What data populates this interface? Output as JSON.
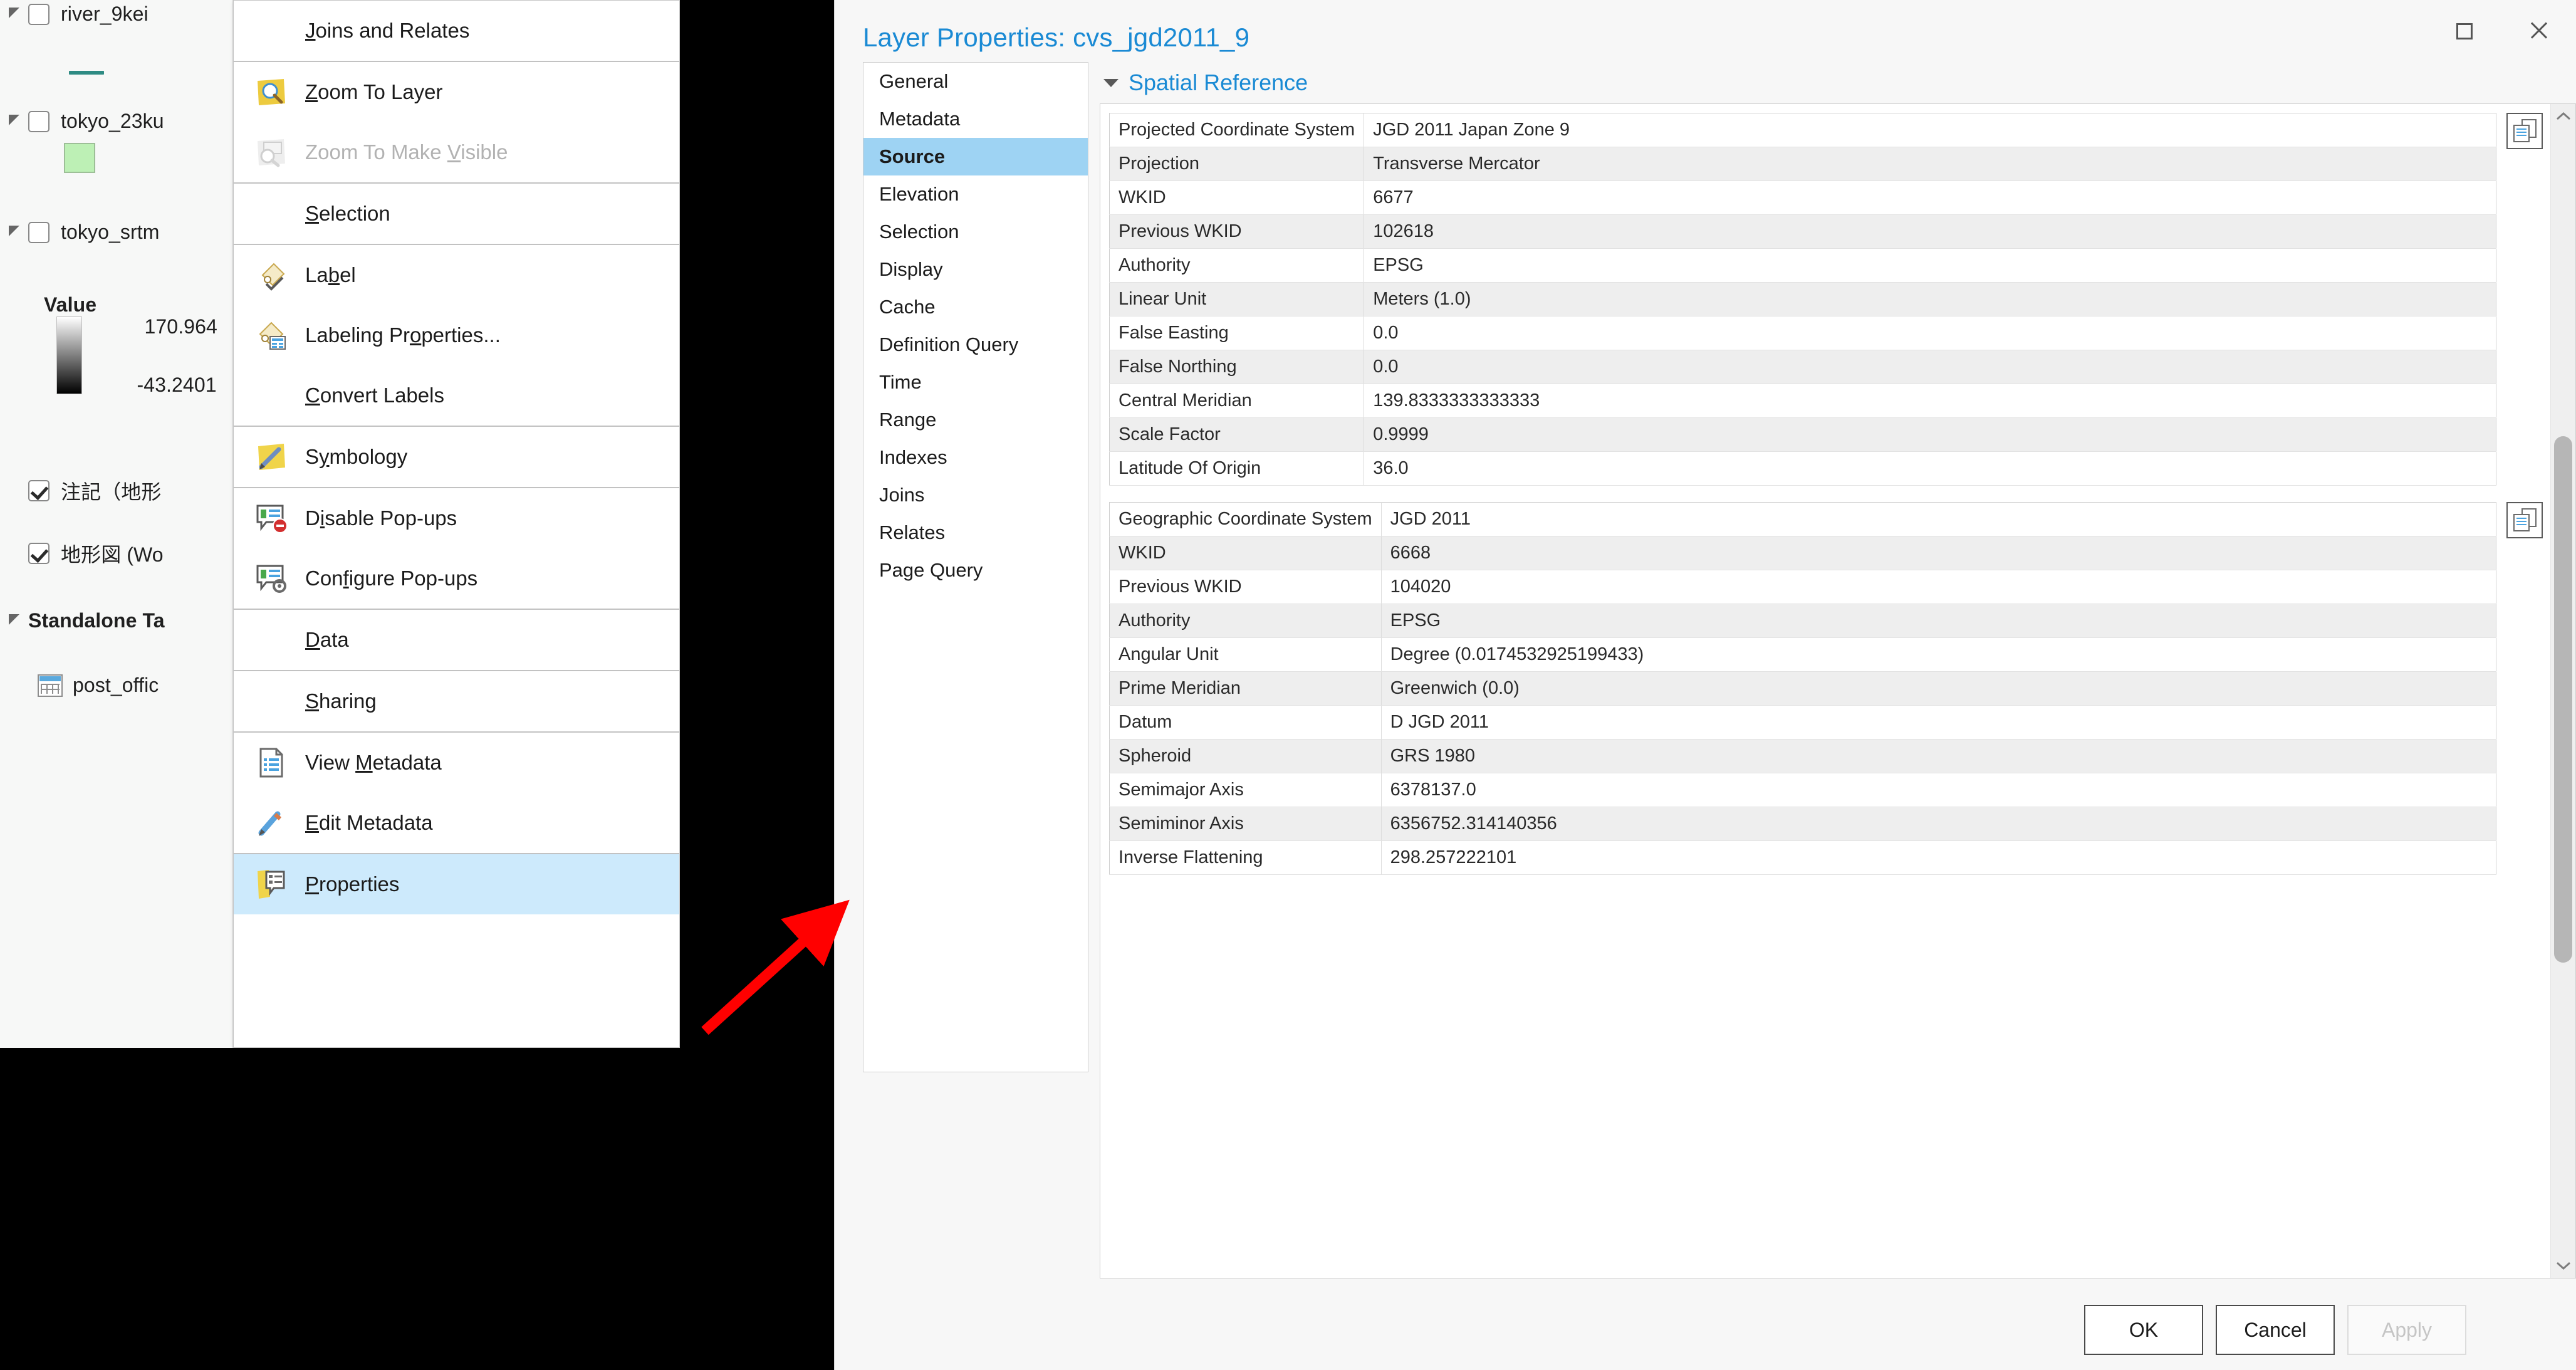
{
  "toc": {
    "items": [
      {
        "type": "layer",
        "label": "river_9kei",
        "checked": false,
        "expanded": true,
        "symbol": "line"
      },
      {
        "type": "layer",
        "label": "tokyo_23ku",
        "checked": false,
        "expanded": true,
        "symbol": "polygon"
      },
      {
        "type": "layer",
        "label": "tokyo_srtm",
        "checked": false,
        "expanded": true,
        "symbol": "ramp"
      },
      {
        "type": "legend-heading",
        "label": "Value"
      },
      {
        "type": "ramp-max",
        "label": "170.964"
      },
      {
        "type": "ramp-min",
        "label": "-43.2401"
      },
      {
        "type": "layer",
        "label": "注記（地形",
        "checked": true,
        "expanded": false
      },
      {
        "type": "layer",
        "label": "地形図 (Wo",
        "checked": true,
        "expanded": false
      },
      {
        "type": "group",
        "label": "Standalone Ta",
        "expanded": true
      },
      {
        "type": "table",
        "label": "post_offic"
      }
    ]
  },
  "context_menu": {
    "items": [
      {
        "label": "Joins and Relates",
        "accel": "J",
        "icon": "none",
        "disabled": false,
        "selected": false,
        "separator_after": true
      },
      {
        "label": "Zoom To Layer",
        "accel": "Z",
        "icon": "zoom-to-layer-icon",
        "disabled": false,
        "selected": false
      },
      {
        "label": "Zoom To Make Visible",
        "accel": "V",
        "icon": "zoom-to-make-visible-icon",
        "disabled": true,
        "selected": false,
        "separator_after": true
      },
      {
        "label": "Selection",
        "accel": "S",
        "icon": "none",
        "disabled": false,
        "selected": false,
        "separator_after": true
      },
      {
        "label": "Label",
        "accel": "b",
        "icon": "label-icon",
        "disabled": false,
        "selected": false
      },
      {
        "label": "Labeling Properties...",
        "accel": "o",
        "icon": "labeling-properties-icon",
        "disabled": false,
        "selected": false
      },
      {
        "label": "Convert Labels",
        "accel": "C",
        "icon": "none",
        "disabled": false,
        "selected": false,
        "separator_after": true
      },
      {
        "label": "Symbology",
        "accel": "y",
        "icon": "symbology-icon",
        "disabled": false,
        "selected": false,
        "separator_after": true
      },
      {
        "label": "Disable Pop-ups",
        "accel": "i",
        "icon": "disable-popups-icon",
        "disabled": false,
        "selected": false
      },
      {
        "label": "Configure Pop-ups",
        "accel": "f",
        "icon": "configure-popups-icon",
        "disabled": false,
        "selected": false,
        "separator_after": true
      },
      {
        "label": "Data",
        "accel": "D",
        "icon": "none",
        "disabled": false,
        "selected": false,
        "separator_after": true
      },
      {
        "label": "Sharing",
        "accel": "S",
        "icon": "none",
        "disabled": false,
        "selected": false,
        "separator_after": true
      },
      {
        "label": "View Metadata",
        "accel": "M",
        "icon": "view-metadata-icon",
        "disabled": false,
        "selected": false
      },
      {
        "label": "Edit Metadata",
        "accel": "E",
        "icon": "edit-metadata-icon",
        "disabled": false,
        "selected": false,
        "separator_after": true
      },
      {
        "label": "Properties",
        "accel": "P",
        "icon": "properties-icon",
        "disabled": false,
        "selected": true
      }
    ]
  },
  "dialog": {
    "title": "Layer Properties: cvs_jgd2011_9",
    "titlebar": {
      "maximize": "maximize-icon",
      "close": "close-icon"
    },
    "tabs": [
      {
        "label": "General",
        "active": false
      },
      {
        "label": "Metadata",
        "active": false
      },
      {
        "label": "Source",
        "active": true
      },
      {
        "label": "Elevation",
        "active": false
      },
      {
        "label": "Selection",
        "active": false
      },
      {
        "label": "Display",
        "active": false
      },
      {
        "label": "Cache",
        "active": false
      },
      {
        "label": "Definition Query",
        "active": false
      },
      {
        "label": "Time",
        "active": false
      },
      {
        "label": "Range",
        "active": false
      },
      {
        "label": "Indexes",
        "active": false
      },
      {
        "label": "Joins",
        "active": false
      },
      {
        "label": "Relates",
        "active": false
      },
      {
        "label": "Page Query",
        "active": false
      }
    ],
    "section": {
      "title": "Spatial Reference",
      "expanded": true
    },
    "tables": [
      {
        "name": "projected-coordinate-system",
        "copy_button": "copy-icon",
        "rows": [
          {
            "key": "Projected Coordinate System",
            "value": "JGD 2011 Japan Zone  9"
          },
          {
            "key": "Projection",
            "value": "Transverse Mercator"
          },
          {
            "key": "WKID",
            "value": "6677"
          },
          {
            "key": "Previous WKID",
            "value": "102618"
          },
          {
            "key": "Authority",
            "value": "EPSG"
          },
          {
            "key": "Linear Unit",
            "value": "Meters (1.0)"
          },
          {
            "key": "False Easting",
            "value": "0.0"
          },
          {
            "key": "False Northing",
            "value": "0.0"
          },
          {
            "key": "Central Meridian",
            "value": "139.8333333333333"
          },
          {
            "key": "Scale Factor",
            "value": "0.9999"
          },
          {
            "key": "Latitude Of Origin",
            "value": "36.0"
          }
        ]
      },
      {
        "name": "geographic-coordinate-system",
        "copy_button": "copy-icon",
        "rows": [
          {
            "key": "Geographic Coordinate System",
            "value": "JGD 2011"
          },
          {
            "key": "WKID",
            "value": "6668"
          },
          {
            "key": "Previous WKID",
            "value": "104020"
          },
          {
            "key": "Authority",
            "value": "EPSG"
          },
          {
            "key": "Angular Unit",
            "value": "Degree (0.0174532925199433)"
          },
          {
            "key": "Prime Meridian",
            "value": "Greenwich (0.0)"
          },
          {
            "key": "Datum",
            "value": "D JGD 2011"
          },
          {
            "key": "Spheroid",
            "value": "GRS 1980"
          },
          {
            "key": "Semimajor Axis",
            "value": "6378137.0"
          },
          {
            "key": "Semiminor Axis",
            "value": "6356752.314140356"
          },
          {
            "key": "Inverse Flattening",
            "value": "298.257222101"
          }
        ]
      }
    ],
    "footer": {
      "ok": "OK",
      "cancel": "Cancel",
      "apply": "Apply",
      "apply_disabled": true
    }
  },
  "annotation": {
    "arrow_color": "#ff0000"
  },
  "colors": {
    "accent_blue": "#1a8ad4",
    "selection_blue": "#cdeafc",
    "tab_active_blue": "#9ed3f3",
    "menu_bg": "#ffffff",
    "toc_bg": "#f7f8f7"
  }
}
